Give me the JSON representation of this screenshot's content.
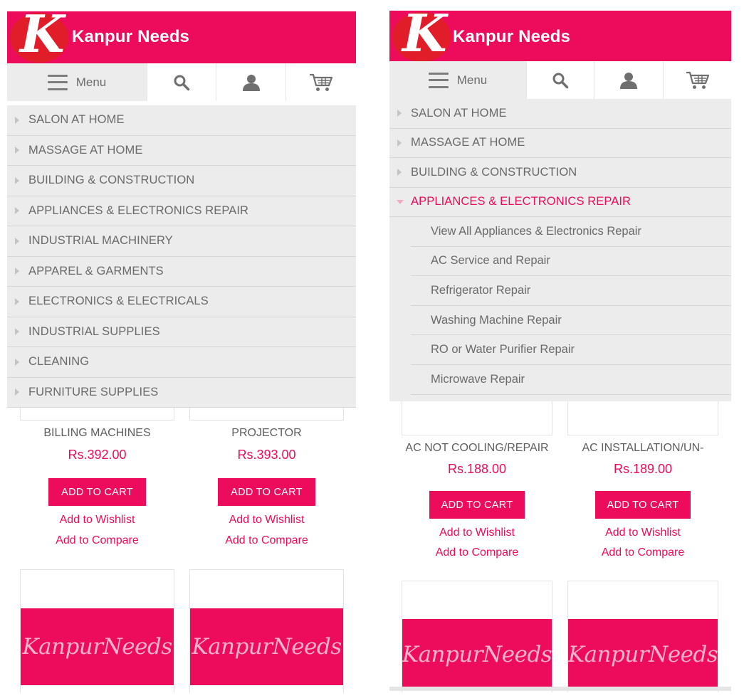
{
  "brand": {
    "name": "Kanpur Needs",
    "logo_letter": "K",
    "color": "#ec0c5b"
  },
  "toolbar": {
    "menu_label": "Menu"
  },
  "icons": {
    "menu": "hamburger-icon",
    "search": "search-icon",
    "account": "user-icon",
    "cart": "cart-icon"
  },
  "left": {
    "categories": [
      "SALON AT HOME",
      "MASSAGE AT HOME",
      "BUILDING & CONSTRUCTION",
      "APPLIANCES & ELECTRONICS REPAIR",
      "INDUSTRIAL MACHINERY",
      "APPAREL & GARMENTS",
      "ELECTRONICS & ELECTRICALS",
      "INDUSTRIAL SUPPLIES",
      "CLEANING",
      "FURNITURE SUPPLIES"
    ],
    "products": [
      {
        "name": "BILLING MACHINES",
        "price": "Rs.392.00",
        "add_to_cart": "ADD TO CART",
        "wishlist": "Add to Wishlist",
        "compare": "Add to Compare"
      },
      {
        "name": "PROJECTOR",
        "price": "Rs.393.00",
        "add_to_cart": "ADD TO CART",
        "wishlist": "Add to Wishlist",
        "compare": "Add to Compare"
      }
    ],
    "card_banners": [
      "KanpurNeeds",
      "KanpurNeeds"
    ]
  },
  "right": {
    "categories": [
      "SALON AT HOME",
      "MASSAGE AT HOME",
      "BUILDING & CONSTRUCTION",
      "APPLIANCES & ELECTRONICS REPAIR"
    ],
    "expanded_index": 3,
    "subcategories": [
      "View All Appliances & Electronics Repair",
      "AC Service and Repair",
      "Refrigerator Repair",
      "Washing Machine Repair",
      "RO or Water Purifier Repair",
      "Microwave Repair"
    ],
    "products": [
      {
        "name": "AC NOT COOLING/REPAIR",
        "price": "Rs.188.00",
        "add_to_cart": "ADD TO CART",
        "wishlist": "Add to Wishlist",
        "compare": "Add to Compare"
      },
      {
        "name": "AC INSTALLATION/UN-",
        "price": "Rs.189.00",
        "add_to_cart": "ADD TO CART",
        "wishlist": "Add to Wishlist",
        "compare": "Add to Compare"
      }
    ],
    "card_banners": [
      "KanpurNeeds",
      "KanpurNeeds"
    ]
  }
}
